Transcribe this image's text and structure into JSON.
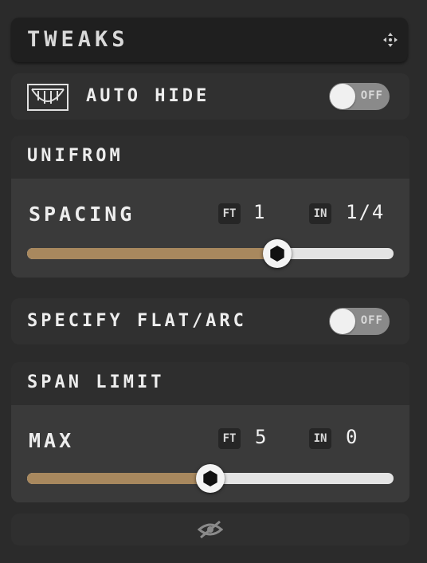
{
  "header": {
    "title": "TWEAKS",
    "move_icon": "move-arrows-icon"
  },
  "auto_hide": {
    "label": "AUTO HIDE",
    "icon": "bowl-icon",
    "toggle_text": "OFF",
    "toggle_on": false
  },
  "uniform": {
    "title": "UNIFROM",
    "spacing": {
      "label": "SPACING",
      "ft_unit": "FT",
      "ft_value": "1",
      "in_unit": "IN",
      "in_value": "1/4",
      "slider_fraction": 0.68
    }
  },
  "flat_arc": {
    "label": "SPECIFY FLAT/ARC",
    "toggle_text": "OFF",
    "toggle_on": false
  },
  "span_limit": {
    "title": "SPAN LIMIT",
    "max": {
      "label": "MAX",
      "ft_unit": "FT",
      "ft_value": "5",
      "in_unit": "IN",
      "in_value": "0",
      "slider_fraction": 0.5
    }
  },
  "footer": {
    "icon": "eye-off-icon"
  },
  "colors": {
    "fill": "#a8885e",
    "track": "#e4e4e4",
    "background": "#2b2b2b"
  }
}
